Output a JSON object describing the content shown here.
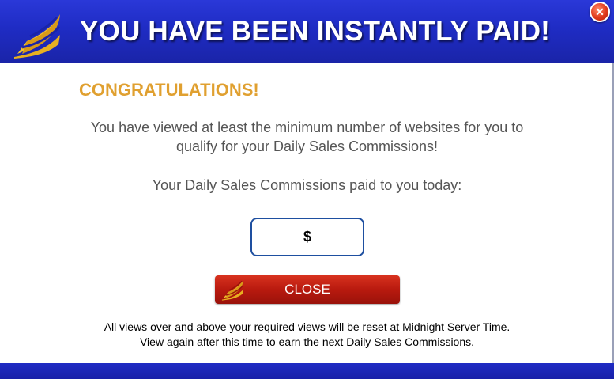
{
  "header": {
    "title": "YOU HAVE BEEN INSTANTLY PAID!",
    "logo_icon": "sail-logo-icon",
    "close_icon": "close-icon",
    "close_symbol": "✕"
  },
  "content": {
    "congratulations": "CONGRATULATIONS!",
    "qualify_text_line1": "You have viewed at least the minimum number of websites for you to",
    "qualify_text_line2": "qualify for your Daily Sales Commissions!",
    "commissions_label": "Your Daily Sales Commissions paid to you today:",
    "amount_value": "$",
    "close_button_label": "CLOSE",
    "footer_line1": "All views over and above your required views will be reset at Midnight Server Time.",
    "footer_line2": "View again after this time to earn the next Daily Sales Commissions."
  },
  "colors": {
    "header_blue": "#1f2cc4",
    "congrats_gold": "#e0a030",
    "button_red": "#b81a0f",
    "amount_border": "#1e4fa0"
  }
}
